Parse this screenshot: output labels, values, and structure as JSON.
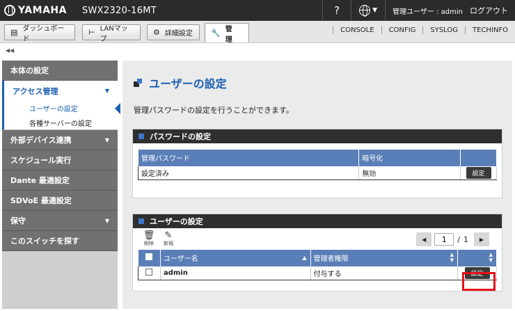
{
  "app": {
    "brand": "YAMAHA",
    "model": "SWX2320-16MT",
    "help_label": "?",
    "user_label": "管理ユーザー : admin",
    "logout_label": "ログアウト"
  },
  "tabs": [
    {
      "label": "ダッシュボード",
      "icon": "dashboard-icon"
    },
    {
      "label": "LANマップ",
      "icon": "lan-map-icon"
    },
    {
      "label": "詳細設定",
      "icon": "gear-icon"
    },
    {
      "label": "管　理",
      "icon": "wrench-icon",
      "active": true
    }
  ],
  "right_links": [
    "CONSOLE",
    "CONFIG",
    "SYSLOG",
    "TECHINFO"
  ],
  "sidebar": {
    "items": [
      {
        "label": "本体の設定"
      },
      {
        "label": "アクセス管理",
        "expanded": true
      },
      {
        "label": "ユーザーの設定"
      },
      {
        "label": "各種サーバーの設定"
      },
      {
        "label": "外部デバイス連携"
      },
      {
        "label": "スケジュール実行"
      },
      {
        "label": "Dante 最適設定"
      },
      {
        "label": "SDVoE 最適設定"
      },
      {
        "label": "保守"
      },
      {
        "label": "このスイッチを探す"
      }
    ]
  },
  "main": {
    "title": "ユーザーの設定",
    "description": "管理パスワードの設定を行うことができます。",
    "password_panel": {
      "title": "パスワードの設定",
      "columns": [
        "管理パスワード",
        "暗号化",
        ""
      ],
      "row": {
        "password": "設定済み",
        "encryption": "無効",
        "button": "設定"
      }
    },
    "user_panel": {
      "title": "ユーザーの設定",
      "toolbar": {
        "delete_label": "削除",
        "new_label": "新規"
      },
      "pager": {
        "current": "1",
        "separator": "/",
        "total": "1"
      },
      "columns": [
        "ユーザー名",
        "管理者権限"
      ],
      "rows": [
        {
          "username": "admin",
          "privilege": "付与する",
          "button": "設定"
        }
      ]
    }
  },
  "colors": {
    "accent": "#1a5fb4",
    "table_header": "#5a7fb8",
    "highlight": "#e8101a"
  }
}
